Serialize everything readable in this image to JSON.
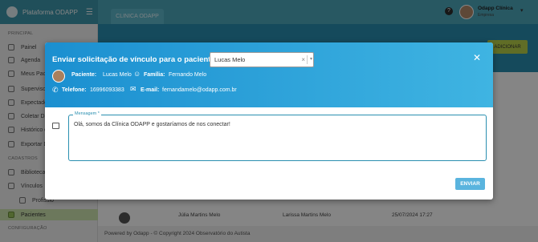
{
  "app": {
    "brand": "Plataforma ODAPP",
    "tab": "CLINICA ODAPP"
  },
  "user": {
    "name": "Odapp Clínica",
    "role": "Empresa"
  },
  "sidebar": {
    "section_principal": "PRINCIPAL",
    "section_cadastros": "CADASTROS",
    "section_config": "CONFIGURAÇÃO",
    "items": [
      {
        "label": "Painel"
      },
      {
        "label": "Agenda"
      },
      {
        "label": "Meus Pacie"
      },
      {
        "label": "Supervisor"
      },
      {
        "label": "Expectador"
      },
      {
        "label": "Coletar Da"
      },
      {
        "label": "Histórico d"
      },
      {
        "label": "Exportar D"
      },
      {
        "label": "Biblioteca"
      },
      {
        "label": "Vínculos"
      },
      {
        "label": "Profissio"
      },
      {
        "label": "Pacientes"
      }
    ]
  },
  "background": {
    "add_button": "ADICIONAR",
    "row": {
      "name": "Júlia Martins Melo",
      "family": "Larissa Martins Melo",
      "date": "25/07/2024 17:27"
    },
    "footer": "Powered by Odapp - © Copyright 2024 Observatório do Autista"
  },
  "modal": {
    "title": "Enviar solicitação de vínculo para o paciente:",
    "select_value": "Lucas Melo",
    "patient_label": "Paciente:",
    "patient_value": "Lucas Melo",
    "family_label": "Família:",
    "family_value": "Fernando Melo",
    "phone_label": "Telefone:",
    "phone_value": "16996093383",
    "email_label": "E-mail:",
    "email_value": "fernandamelo@odapp.com.br",
    "message_label": "Mensagem *",
    "message_value": "Olá, somos da Clínica ODAPP e gostaríamos de nos conectar!",
    "send_button": "ENVIAR"
  }
}
